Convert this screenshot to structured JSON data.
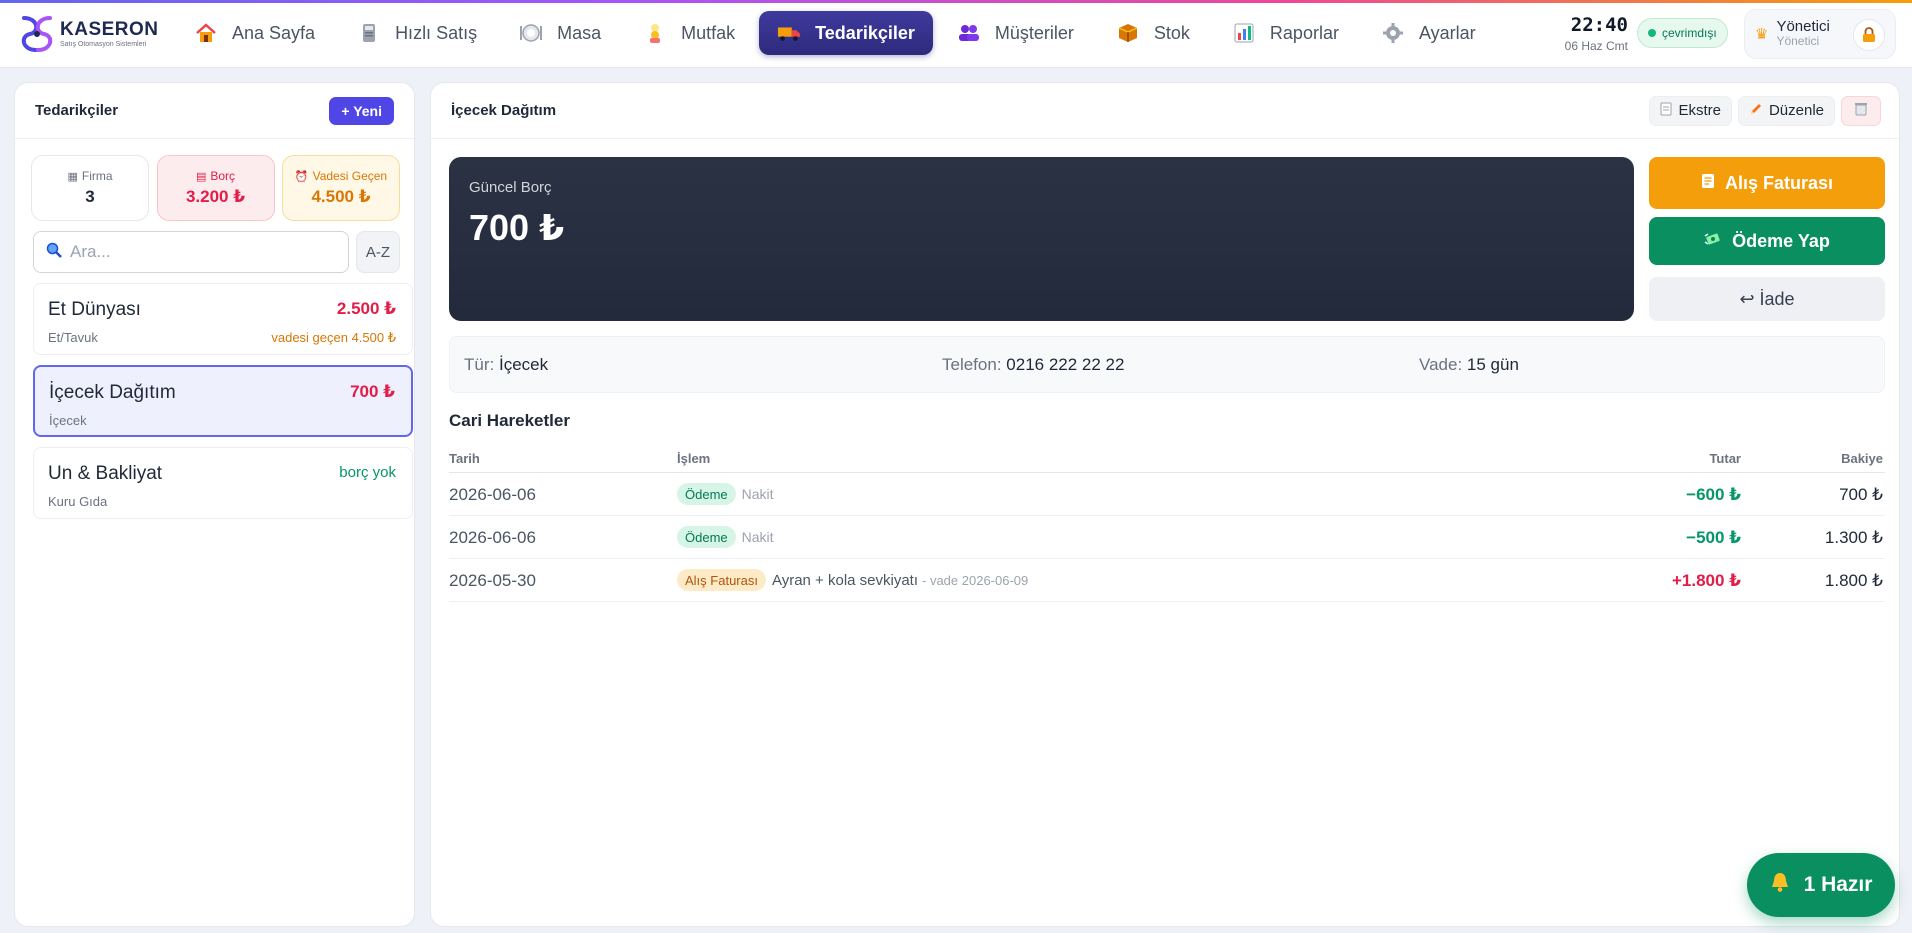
{
  "brand": {
    "title": "KASERON",
    "subtitle": "Satış Otomasyon Sistemleri"
  },
  "nav": [
    {
      "label": "Ana Sayfa",
      "icon": "home-icon"
    },
    {
      "label": "Hızlı Satış",
      "icon": "register-icon"
    },
    {
      "label": "Masa",
      "icon": "plate-icon"
    },
    {
      "label": "Mutfak",
      "icon": "chef-icon"
    },
    {
      "label": "Tedarikçiler",
      "icon": "truck-icon",
      "active": true
    },
    {
      "label": "Müşteriler",
      "icon": "users-icon"
    },
    {
      "label": "Stok",
      "icon": "box-icon"
    },
    {
      "label": "Raporlar",
      "icon": "chart-icon"
    },
    {
      "label": "Ayarlar",
      "icon": "gear-icon"
    }
  ],
  "clock": {
    "time": "22:40",
    "date": "06 Haz Cmt"
  },
  "connection": {
    "label": "çevrimdışı"
  },
  "user": {
    "name": "Yönetici",
    "role": "Yönetici"
  },
  "left": {
    "title": "Tedarikçiler",
    "new_label": "+ Yeni",
    "stats": {
      "firma": {
        "label": "Firma",
        "value": "3"
      },
      "borc": {
        "label": "Borç",
        "value": "3.200 ₺"
      },
      "vade": {
        "label": "Vadesi Geçen",
        "value": "4.500 ₺"
      }
    },
    "search_placeholder": "Ara...",
    "sort_label": "A-Z",
    "suppliers": [
      {
        "name": "Et Dünyası",
        "category": "Et/Tavuk",
        "amount": "2.500 ₺",
        "note": "vadesi geçen 4.500 ₺"
      },
      {
        "name": "İçecek Dağıtım",
        "category": "İçecek",
        "amount": "700 ₺",
        "note": ""
      },
      {
        "name": "Un & Bakliyat",
        "category": "Kuru Gıda",
        "amount": "",
        "note": "borç yok"
      }
    ]
  },
  "detail": {
    "title": "İçecek Dağıtım",
    "buttons": {
      "statement": "Ekstre",
      "edit": "Düzenle"
    },
    "debt_label": "Güncel Borç",
    "debt_value": "700 ₺",
    "actions": {
      "invoice": "Alış Faturası",
      "pay": "Ödeme Yap",
      "refund": "↩ İade"
    },
    "info": {
      "type_key": "Tür:",
      "type_val": "İçecek",
      "phone_key": "Telefon:",
      "phone_val": "0216 222 22 22",
      "due_key": "Vade:",
      "due_val": "15 gün"
    },
    "movements_title": "Cari Hareketler",
    "columns": {
      "date": "Tarih",
      "op": "İşlem",
      "amount": "Tutar",
      "balance": "Bakiye"
    },
    "rows": [
      {
        "date": "2026-06-06",
        "badge": "Ödeme",
        "note": "Nakit",
        "desc": "",
        "due": "",
        "amount": "−600 ₺",
        "balance": "700 ₺"
      },
      {
        "date": "2026-06-06",
        "badge": "Ödeme",
        "note": "Nakit",
        "desc": "",
        "due": "",
        "amount": "−500 ₺",
        "balance": "1.300 ₺"
      },
      {
        "date": "2026-05-30",
        "badge": "Alış Faturası",
        "note": "",
        "desc": "Ayran + kola sevkiyatı",
        "due": "- vade 2026-06-09",
        "amount": "+1.800 ₺",
        "balance": "1.800 ₺"
      }
    ]
  },
  "ready": {
    "label": "1 Hazır"
  }
}
